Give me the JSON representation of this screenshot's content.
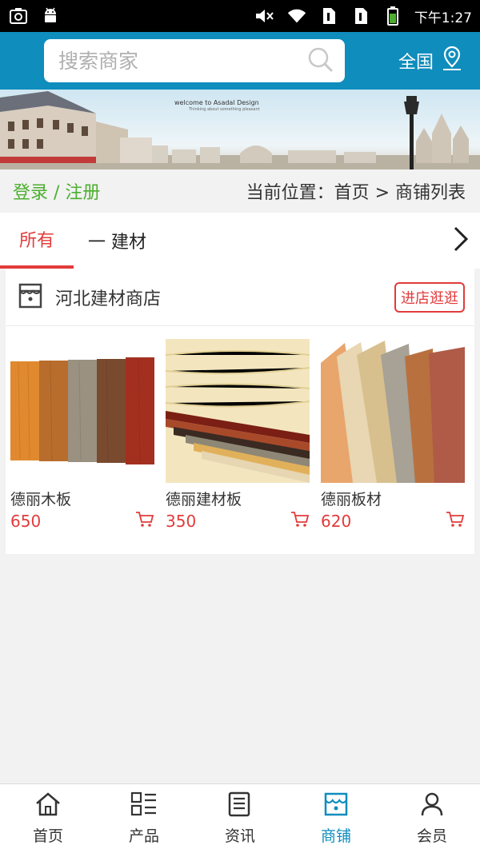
{
  "status_bar": {
    "time": "下午1:27"
  },
  "header": {
    "search_placeholder": "搜索商家",
    "region_label": "全国"
  },
  "banner": {
    "line1": "welcome to Asadal Design",
    "line2": "Thinking about something pleasant"
  },
  "crumbbar": {
    "login_label": "登录 / 注册",
    "breadcrumb": "当前位置：首页 > 商铺列表"
  },
  "tabs": {
    "active": "所有",
    "category": "一 建材"
  },
  "shop": {
    "name": "河北建材商店",
    "enter_label": "进店逛逛",
    "products": [
      {
        "name": "德丽木板",
        "price": "650"
      },
      {
        "name": "德丽建材板",
        "price": "350"
      },
      {
        "name": "德丽板材",
        "price": "620"
      }
    ]
  },
  "tabbar": {
    "items": [
      {
        "label": "首页",
        "icon": "home-icon"
      },
      {
        "label": "产品",
        "icon": "grid-list-icon"
      },
      {
        "label": "资讯",
        "icon": "news-icon"
      },
      {
        "label": "商铺",
        "icon": "shop-icon"
      },
      {
        "label": "会员",
        "icon": "user-icon"
      }
    ],
    "active_index": 3
  },
  "colors": {
    "accent": "#0f8dbd",
    "price": "#e23b3b",
    "login": "#4caf2f"
  }
}
